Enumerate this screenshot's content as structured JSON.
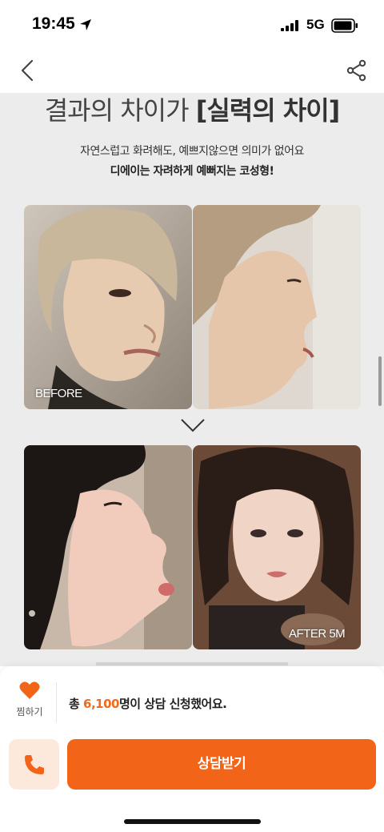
{
  "status_bar": {
    "time": "19:45",
    "network": "5G",
    "icons": [
      "location-arrow-icon",
      "signal-icon",
      "battery-icon"
    ]
  },
  "nav": {
    "back_icon": "chevron-left-icon",
    "share_icon": "share-icon"
  },
  "content": {
    "headline_light": "결과의 차이가",
    "headline_bold": "[실력의 차이]",
    "subtitle_line1": "자연스럽고 화려해도, 예쁘지않으면 의미가 없어요",
    "subtitle_line2": "디에이는 자려하게 예뻐지는 코성형!",
    "before_label": "BEFORE",
    "after_label": "AFTER 5M",
    "arrow_icon": "chevron-down-icon"
  },
  "bottom_bar": {
    "wish_label": "찜하기",
    "wish_icon": "heart-icon",
    "count_prefix": "총 ",
    "count_value": "6,100",
    "count_suffix": "명이 상담 신청했어요.",
    "call_icon": "phone-icon",
    "consult_button": "상담받기"
  },
  "colors": {
    "accent": "#f26519",
    "accent_light": "#fde9dc",
    "content_bg": "#ececec"
  }
}
